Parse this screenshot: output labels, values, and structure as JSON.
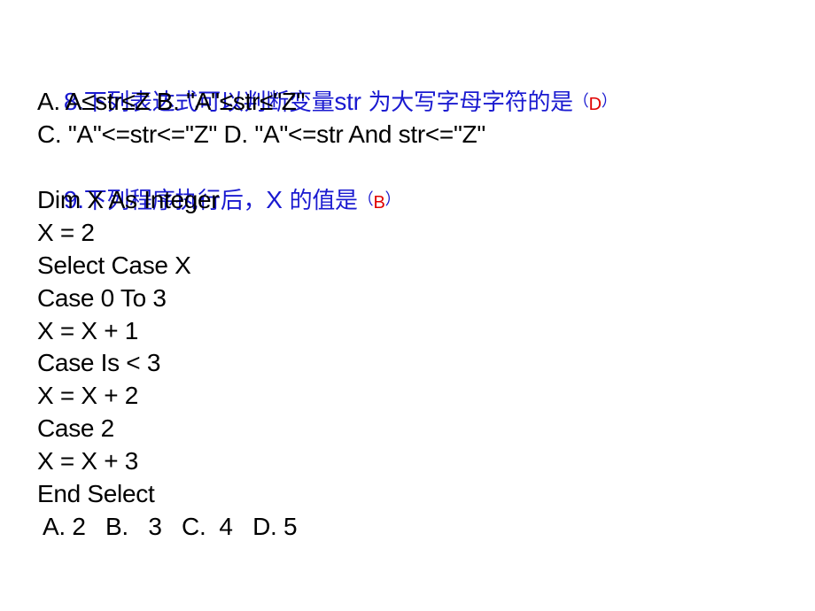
{
  "question8": {
    "number": "8.",
    "stem_part1": "下列表达式可以判断变量",
    "stem_var": "str",
    "stem_part2": " 为大写字母字符的是",
    "paren_open": "（",
    "answer": "D",
    "paren_close": "）",
    "option_line1": "A. A≤str≤Z B. \"A\"≤str≤\"Z\"",
    "option_line2": "C. \"A\"<=str<=\"Z\" D. \"A\"<=str And str<=\"Z\""
  },
  "question9": {
    "number": "9.",
    "stem_part1": "下列程序执行后，",
    "stem_var": "X",
    "stem_part2": " 的值是",
    "paren_open": "（",
    "answer": "B",
    "paren_close": "）",
    "code_lines": [
      "Dim X As Integer",
      "X = 2",
      "Select Case X",
      "Case 0 To 3",
      "X = X + 1",
      "Case Is < 3",
      "X = X + 2",
      "Case 2",
      "X = X + 3",
      "End Select"
    ],
    "options": "A. 2   B.   3   C.  4   D. 5"
  },
  "colors": {
    "question_title": "#1a1ad0",
    "answer": "#e00000",
    "body_text": "#000000",
    "background": "#ffffff"
  }
}
